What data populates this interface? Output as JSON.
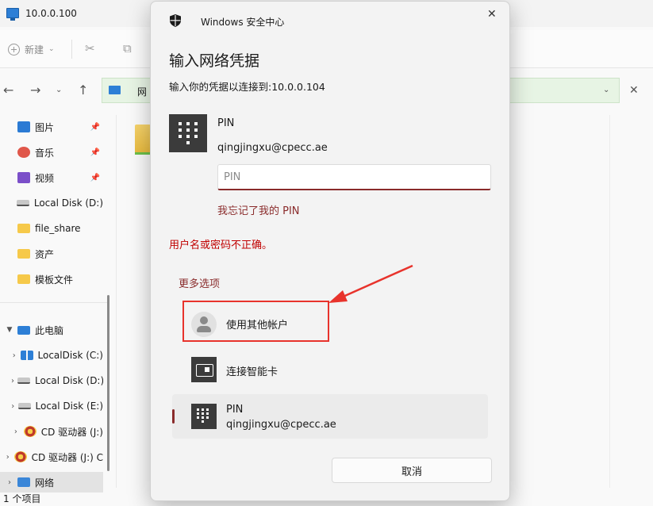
{
  "explorer": {
    "window_title": "10.0.0.100",
    "toolbar": {
      "new_label": "新建"
    },
    "address_text": "网",
    "sidebar": [
      {
        "label": "图片",
        "icon": "pictures-icon",
        "pinned": true
      },
      {
        "label": "音乐",
        "icon": "music-icon",
        "pinned": true
      },
      {
        "label": "视频",
        "icon": "videos-icon",
        "pinned": true
      },
      {
        "label": "Local Disk (D:)",
        "icon": "disk-icon",
        "pinned": false
      },
      {
        "label": "file_share",
        "icon": "folder-icon",
        "pinned": false
      },
      {
        "label": "资产",
        "icon": "folder-icon",
        "pinned": false
      },
      {
        "label": "模板文件",
        "icon": "folder-icon",
        "pinned": false
      },
      {
        "label": "此电脑",
        "icon": "computer-icon",
        "pinned": false
      },
      {
        "label": "LocalDisk (C:)",
        "icon": "windows-disk-icon",
        "pinned": false
      },
      {
        "label": "Local Disk (D:)",
        "icon": "disk-icon",
        "pinned": false
      },
      {
        "label": "Local Disk (E:)",
        "icon": "disk-icon",
        "pinned": false
      },
      {
        "label": "CD 驱动器 (J:)",
        "icon": "cd-drive-icon",
        "pinned": false
      },
      {
        "label": "CD 驱动器 (J:) C",
        "icon": "cd-drive-icon",
        "pinned": false
      },
      {
        "label": "网络",
        "icon": "network-icon",
        "pinned": false
      }
    ],
    "status": "1 个项目"
  },
  "dialog": {
    "app_name": "Windows 安全中心",
    "title": "输入网络凭据",
    "subtitle": "输入你的凭据以连接到:10.0.0.104",
    "credential_type": "PIN",
    "username": "qingjingxu@cpecc.ae",
    "pin_placeholder": "PIN",
    "forgot_link": "我忘记了我的 PIN",
    "error_message": "用户名或密码不正确。",
    "more_options_label": "更多选项",
    "options": [
      {
        "label": "使用其他帐户"
      },
      {
        "label": "连接智能卡"
      },
      {
        "label": "PIN",
        "sublabel": "qingjingxu@cpecc.ae"
      }
    ],
    "cancel_label": "取消"
  },
  "colors": {
    "accent": "#8a2b2b",
    "error": "#c00000",
    "annotation": "#e8332c"
  }
}
